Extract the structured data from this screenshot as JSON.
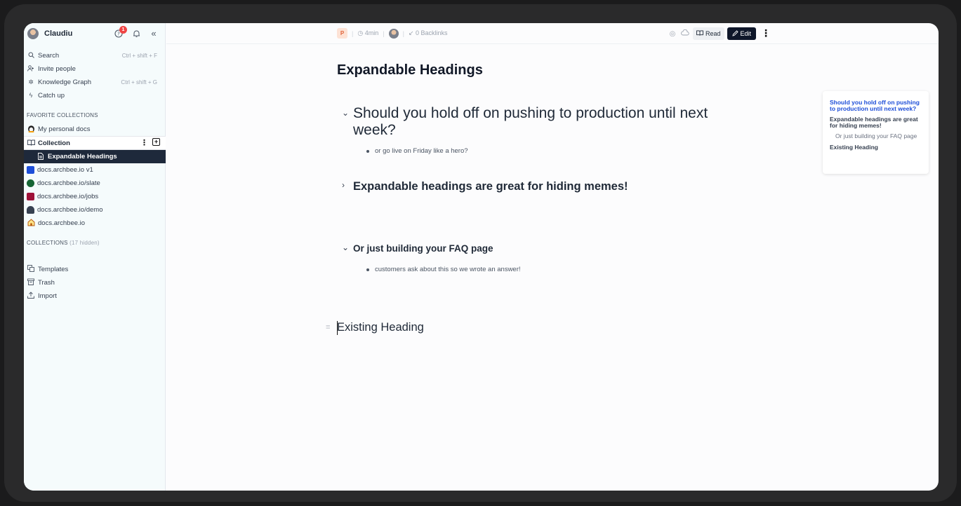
{
  "user": {
    "name": "Claudiu",
    "notification_count": "1"
  },
  "sidebar": {
    "search": {
      "label": "Search",
      "shortcut": "Ctrl + shift + F"
    },
    "invite": {
      "label": "Invite people"
    },
    "graph": {
      "label": "Knowledge Graph",
      "shortcut": "Ctrl + shift + G"
    },
    "catchup": {
      "label": "Catch up"
    },
    "favorites_heading": "FAVORITE COLLECTIONS",
    "favorites": [
      {
        "label": "My personal docs"
      }
    ],
    "collection": {
      "label": "Collection"
    },
    "active_doc": "Expandable Headings",
    "spaces": [
      {
        "label": "docs.archbee.io v1",
        "color": "#1d4ed8"
      },
      {
        "label": "docs.archbee.io/slate",
        "color": "#166534"
      },
      {
        "label": "docs.archbee.io/jobs",
        "color": "#9f1239"
      },
      {
        "label": "docs.archbee.io/demo",
        "color": "#374151"
      },
      {
        "label": "docs.archbee.io",
        "color": "#b45309"
      }
    ],
    "collections_heading": "COLLECTIONS",
    "collections_hidden": "(17 hidden)",
    "bottom": [
      {
        "label": "Templates"
      },
      {
        "label": "Trash"
      },
      {
        "label": "Import"
      }
    ]
  },
  "topbar": {
    "space_initial": "P",
    "read_time": "4min",
    "backlinks": "0 Backlinks",
    "read_label": "Read",
    "edit_label": "Edit"
  },
  "doc": {
    "title": "Expandable Headings",
    "sections": [
      {
        "heading": "Should you hold off on pushing to production until next week?",
        "bullet": "or go live on Friday like a hero?"
      },
      {
        "heading": "Expandable headings are great for hiding memes!"
      },
      {
        "heading": "Or just building your FAQ page",
        "bullet": "customers ask about this so we wrote an answer!"
      }
    ],
    "existing_heading": "Existing Heading"
  },
  "toc": [
    {
      "label": "Should you hold off on pushing to production until next week?"
    },
    {
      "label": "Expandable headings are great for hiding memes!"
    },
    {
      "label": "Or just building your FAQ page"
    },
    {
      "label": "Existing Heading"
    }
  ]
}
